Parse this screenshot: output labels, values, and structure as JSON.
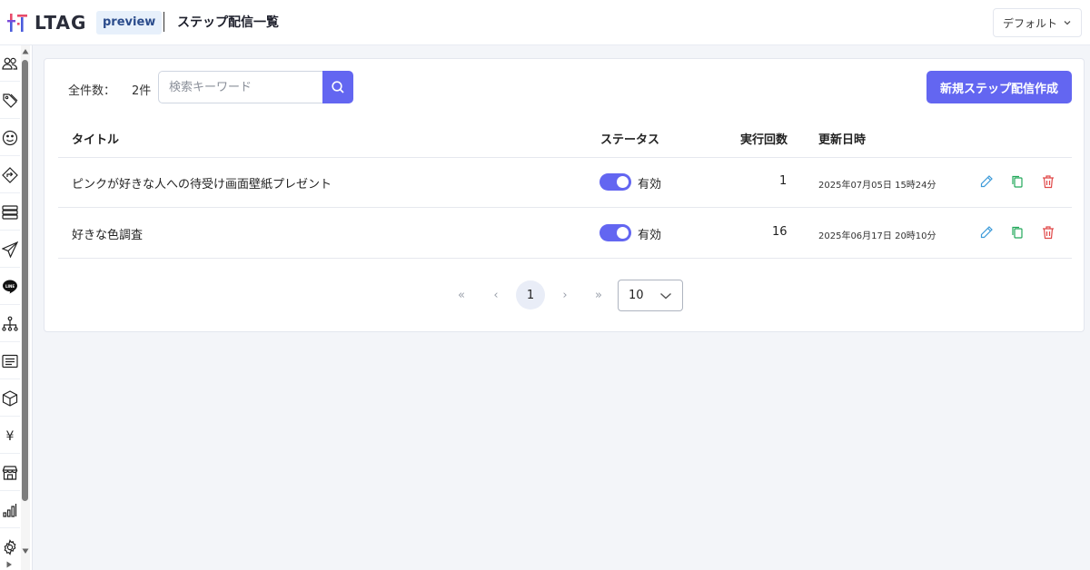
{
  "header": {
    "logo_text": "LTAG",
    "badge": "preview",
    "title": "ステップ配信一覧",
    "profile_select": "デフォルト"
  },
  "sidebar": {
    "icons": [
      "users-icon",
      "tag-icon",
      "smile-icon",
      "diamond-direction-icon",
      "list-stack-icon",
      "send-icon",
      "line-icon",
      "hierarchy-icon",
      "message-lines-icon",
      "box-icon",
      "yen-icon",
      "store-icon",
      "bar-chart-icon",
      "gear-icon"
    ]
  },
  "toolbar": {
    "count_label": "全件数：",
    "count_value": "2件",
    "search_placeholder": "検索キーワード",
    "create_label": "新規ステップ配信作成"
  },
  "table": {
    "headers": {
      "title": "タイトル",
      "status": "ステータス",
      "runs": "実行回数",
      "updated": "更新日時"
    },
    "rows": [
      {
        "title": "ピンクが好きな人への待受け画面壁紙プレゼント",
        "status": "有効",
        "enabled": true,
        "runs": "1",
        "updated": "2025年07月05日 15時24分"
      },
      {
        "title": "好きな色調査",
        "status": "有効",
        "enabled": true,
        "runs": "16",
        "updated": "2025年06月17日 20時10分"
      }
    ]
  },
  "pagination": {
    "first": "«",
    "prev": "‹",
    "current": "1",
    "next": "›",
    "last": "»",
    "per_page": "10"
  },
  "colors": {
    "accent": "#6366f1",
    "edit": "#3b9ad9",
    "copy": "#22a85a",
    "delete": "#e04848"
  }
}
